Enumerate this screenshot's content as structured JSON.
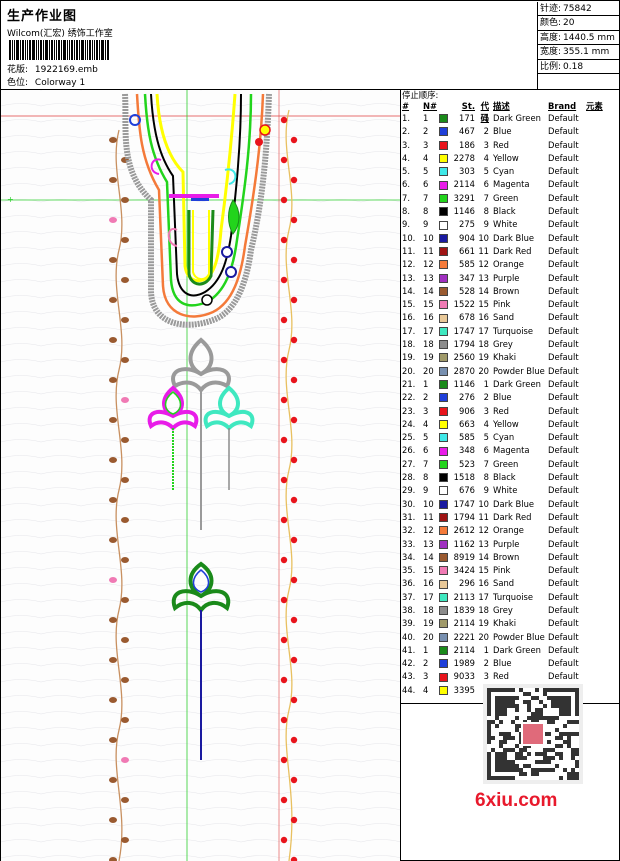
{
  "header": {
    "title": "生产作业图",
    "company": "Wilcom(汇宏) 绣饰工作室",
    "design_label": "花版:",
    "design_value": "1922169.emb",
    "colorway_label": "色位:",
    "colorway_value": "Colorway 1"
  },
  "stats": [
    {
      "label": "针迹:",
      "value": "75842"
    },
    {
      "label": "颜色:",
      "value": "20"
    },
    {
      "label": "高度:",
      "value": "1440.5 mm"
    },
    {
      "label": "宽度:",
      "value": "355.1 mm"
    },
    {
      "label": "比例:",
      "value": "0.18"
    },
    {
      "label": "",
      "value": ""
    }
  ],
  "table": {
    "title": "停止顺序:",
    "headers": {
      "idx": "#",
      "n": "N#",
      "st": "St.",
      "code": "代码",
      "desc": "描述",
      "brand": "Brand",
      "element": "元素"
    },
    "rows": [
      {
        "idx": "1.",
        "n": "1",
        "color": "#1a8a1a",
        "st": "171",
        "code": "1",
        "desc": "Dark Green",
        "brand": "Default"
      },
      {
        "idx": "2.",
        "n": "2",
        "color": "#1f3fd9",
        "st": "467",
        "code": "2",
        "desc": "Blue",
        "brand": "Default"
      },
      {
        "idx": "3.",
        "n": "3",
        "color": "#e8141c",
        "st": "186",
        "code": "3",
        "desc": "Red",
        "brand": "Default"
      },
      {
        "idx": "4.",
        "n": "4",
        "color": "#ffff00",
        "st": "2278",
        "code": "4",
        "desc": "Yellow",
        "brand": "Default"
      },
      {
        "idx": "5.",
        "n": "5",
        "color": "#3fe8e8",
        "st": "303",
        "code": "5",
        "desc": "Cyan",
        "brand": "Default"
      },
      {
        "idx": "6.",
        "n": "6",
        "color": "#e81ce8",
        "st": "2114",
        "code": "6",
        "desc": "Magenta",
        "brand": "Default"
      },
      {
        "idx": "7.",
        "n": "7",
        "color": "#22d41c",
        "st": "3291",
        "code": "7",
        "desc": "Green",
        "brand": "Default"
      },
      {
        "idx": "8.",
        "n": "8",
        "color": "#000000",
        "st": "1146",
        "code": "8",
        "desc": "Black",
        "brand": "Default"
      },
      {
        "idx": "9.",
        "n": "9",
        "color": "#ffffff",
        "st": "275",
        "code": "9",
        "desc": "White",
        "brand": "Default"
      },
      {
        "idx": "10.",
        "n": "10",
        "color": "#1a1aa0",
        "st": "904",
        "code": "10",
        "desc": "Dark Blue",
        "brand": "Default"
      },
      {
        "idx": "11.",
        "n": "11",
        "color": "#a01414",
        "st": "661",
        "code": "11",
        "desc": "Dark Red",
        "brand": "Default"
      },
      {
        "idx": "12.",
        "n": "12",
        "color": "#f47a3a",
        "st": "585",
        "code": "12",
        "desc": "Orange",
        "brand": "Default"
      },
      {
        "idx": "13.",
        "n": "13",
        "color": "#a030c0",
        "st": "347",
        "code": "13",
        "desc": "Purple",
        "brand": "Default"
      },
      {
        "idx": "14.",
        "n": "14",
        "color": "#9a5a30",
        "st": "528",
        "code": "14",
        "desc": "Brown",
        "brand": "Default"
      },
      {
        "idx": "15.",
        "n": "15",
        "color": "#f07ab4",
        "st": "1522",
        "code": "15",
        "desc": "Pink",
        "brand": "Default"
      },
      {
        "idx": "16.",
        "n": "16",
        "color": "#e8c898",
        "st": "678",
        "code": "16",
        "desc": "Sand",
        "brand": "Default"
      },
      {
        "idx": "17.",
        "n": "17",
        "color": "#3fe8c0",
        "st": "1747",
        "code": "17",
        "desc": "Turquoise",
        "brand": "Default"
      },
      {
        "idx": "18.",
        "n": "18",
        "color": "#8c8c8c",
        "st": "1794",
        "code": "18",
        "desc": "Grey",
        "brand": "Default"
      },
      {
        "idx": "19.",
        "n": "19",
        "color": "#a09a6a",
        "st": "2560",
        "code": "19",
        "desc": "Khaki",
        "brand": "Default"
      },
      {
        "idx": "20.",
        "n": "20",
        "color": "#7890b0",
        "st": "2870",
        "code": "20",
        "desc": "Powder Blue",
        "brand": "Default"
      },
      {
        "idx": "21.",
        "n": "1",
        "color": "#1a8a1a",
        "st": "1146",
        "code": "1",
        "desc": "Dark Green",
        "brand": "Default"
      },
      {
        "idx": "22.",
        "n": "2",
        "color": "#1f3fd9",
        "st": "276",
        "code": "2",
        "desc": "Blue",
        "brand": "Default"
      },
      {
        "idx": "23.",
        "n": "3",
        "color": "#e8141c",
        "st": "906",
        "code": "3",
        "desc": "Red",
        "brand": "Default"
      },
      {
        "idx": "24.",
        "n": "4",
        "color": "#ffff00",
        "st": "663",
        "code": "4",
        "desc": "Yellow",
        "brand": "Default"
      },
      {
        "idx": "25.",
        "n": "5",
        "color": "#3fe8e8",
        "st": "585",
        "code": "5",
        "desc": "Cyan",
        "brand": "Default"
      },
      {
        "idx": "26.",
        "n": "6",
        "color": "#e81ce8",
        "st": "348",
        "code": "6",
        "desc": "Magenta",
        "brand": "Default"
      },
      {
        "idx": "27.",
        "n": "7",
        "color": "#22d41c",
        "st": "523",
        "code": "7",
        "desc": "Green",
        "brand": "Default"
      },
      {
        "idx": "28.",
        "n": "8",
        "color": "#000000",
        "st": "1518",
        "code": "8",
        "desc": "Black",
        "brand": "Default"
      },
      {
        "idx": "29.",
        "n": "9",
        "color": "#ffffff",
        "st": "676",
        "code": "9",
        "desc": "White",
        "brand": "Default"
      },
      {
        "idx": "30.",
        "n": "10",
        "color": "#1a1aa0",
        "st": "1747",
        "code": "10",
        "desc": "Dark Blue",
        "brand": "Default"
      },
      {
        "idx": "31.",
        "n": "11",
        "color": "#a01414",
        "st": "1794",
        "code": "11",
        "desc": "Dark Red",
        "brand": "Default"
      },
      {
        "idx": "32.",
        "n": "12",
        "color": "#f47a3a",
        "st": "2612",
        "code": "12",
        "desc": "Orange",
        "brand": "Default"
      },
      {
        "idx": "33.",
        "n": "13",
        "color": "#a030c0",
        "st": "1162",
        "code": "13",
        "desc": "Purple",
        "brand": "Default"
      },
      {
        "idx": "34.",
        "n": "14",
        "color": "#9a5a30",
        "st": "8919",
        "code": "14",
        "desc": "Brown",
        "brand": "Default"
      },
      {
        "idx": "35.",
        "n": "15",
        "color": "#f07ab4",
        "st": "3424",
        "code": "15",
        "desc": "Pink",
        "brand": "Default"
      },
      {
        "idx": "36.",
        "n": "16",
        "color": "#e8c898",
        "st": "296",
        "code": "16",
        "desc": "Sand",
        "brand": "Default"
      },
      {
        "idx": "37.",
        "n": "17",
        "color": "#3fe8c0",
        "st": "2113",
        "code": "17",
        "desc": "Turquoise",
        "brand": "Default"
      },
      {
        "idx": "38.",
        "n": "18",
        "color": "#8c8c8c",
        "st": "1839",
        "code": "18",
        "desc": "Grey",
        "brand": "Default"
      },
      {
        "idx": "39.",
        "n": "19",
        "color": "#a09a6a",
        "st": "2114",
        "code": "19",
        "desc": "Khaki",
        "brand": "Default"
      },
      {
        "idx": "40.",
        "n": "20",
        "color": "#7890b0",
        "st": "2221",
        "code": "20",
        "desc": "Powder Blue",
        "brand": "Default"
      },
      {
        "idx": "41.",
        "n": "1",
        "color": "#1a8a1a",
        "st": "2114",
        "code": "1",
        "desc": "Dark Green",
        "brand": "Default"
      },
      {
        "idx": "42.",
        "n": "2",
        "color": "#1f3fd9",
        "st": "1989",
        "code": "2",
        "desc": "Blue",
        "brand": "Default"
      },
      {
        "idx": "43.",
        "n": "3",
        "color": "#e8141c",
        "st": "9033",
        "code": "3",
        "desc": "Red",
        "brand": "Default"
      },
      {
        "idx": "44.",
        "n": "4",
        "color": "#ffff00",
        "st": "3395",
        "code": "",
        "desc": "",
        "brand": ""
      }
    ]
  },
  "watermark": "6xiu.com"
}
